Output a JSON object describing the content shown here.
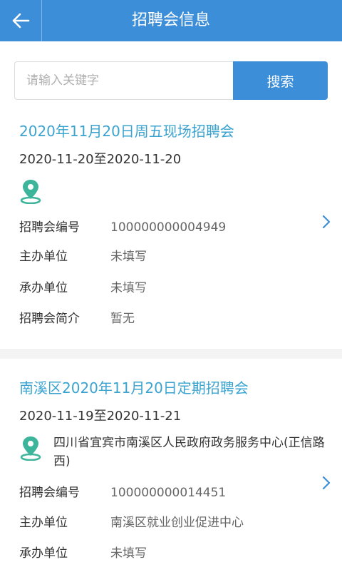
{
  "header": {
    "title": "招聘会信息"
  },
  "search": {
    "placeholder": "请输入关键字",
    "button_label": "搜索"
  },
  "jobfairs": [
    {
      "title": "2020年11月20日周五现场招聘会",
      "date_range": "2020-11-20至2020-11-20",
      "location": "",
      "fields": [
        {
          "label": "招聘会编号",
          "value": "100000000004949"
        },
        {
          "label": "主办单位",
          "value": "未填写"
        },
        {
          "label": "承办单位",
          "value": "未填写"
        },
        {
          "label": "招聘会简介",
          "value": "暂无"
        }
      ]
    },
    {
      "title": "南溪区2020年11月20日定期招聘会",
      "date_range": "2020-11-19至2020-11-21",
      "location": "四川省宜宾市南溪区人民政府政务服务中心(正信路西)",
      "fields": [
        {
          "label": "招聘会编号",
          "value": "100000000014451"
        },
        {
          "label": "主办单位",
          "value": "南溪区就业创业促进中心"
        },
        {
          "label": "承办单位",
          "value": "未填写"
        }
      ]
    }
  ],
  "colors": {
    "primary": "#3d8ed8",
    "title_accent": "#3aa3d0",
    "location_icon": "#3cb59a"
  },
  "icons": {
    "back": "arrow-left-icon",
    "location": "map-pin-icon",
    "chevron": "chevron-right-icon"
  }
}
